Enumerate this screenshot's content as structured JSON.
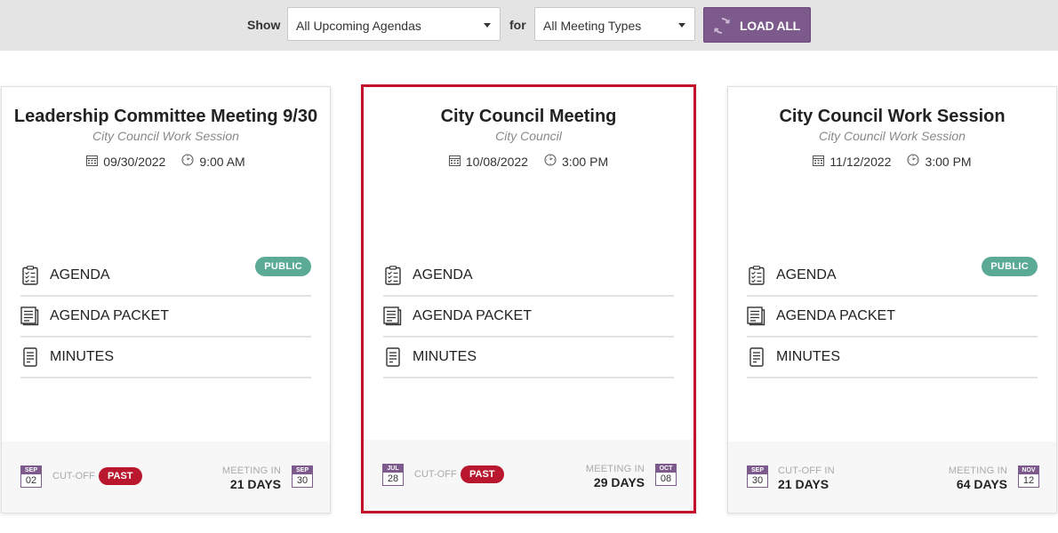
{
  "filters": {
    "show_label": "Show",
    "show_value": "All Upcoming Agendas",
    "for_label": "for",
    "for_value": "All Meeting Types",
    "load_all_label": "LOAD ALL"
  },
  "colors": {
    "accent": "#7d5a8c",
    "selected_border": "#c4102a",
    "public_badge": "#5aaa96",
    "past_badge": "#b8172e"
  },
  "cards": [
    {
      "title": "Leadership Committee Meeting 9/30",
      "subtitle": "City Council Work Session",
      "date": "09/30/2022",
      "time": "9:00 AM",
      "selected": false,
      "docs": [
        {
          "label": "AGENDA",
          "icon": "agenda-checklist-icon",
          "badge": "PUBLIC"
        },
        {
          "label": "AGENDA PACKET",
          "icon": "agenda-packet-icon"
        },
        {
          "label": "MINUTES",
          "icon": "minutes-icon"
        }
      ],
      "cutoff": {
        "month": "SEP",
        "day": "02",
        "label": "CUT-OFF",
        "status": "PAST"
      },
      "meeting": {
        "label": "MEETING IN",
        "days": "21 DAYS",
        "month": "SEP",
        "day": "30"
      }
    },
    {
      "title": "City Council Meeting",
      "subtitle": "City Council",
      "date": "10/08/2022",
      "time": "3:00 PM",
      "selected": true,
      "docs": [
        {
          "label": "AGENDA",
          "icon": "agenda-checklist-icon"
        },
        {
          "label": "AGENDA PACKET",
          "icon": "agenda-packet-icon"
        },
        {
          "label": "MINUTES",
          "icon": "minutes-icon"
        }
      ],
      "cutoff": {
        "month": "JUL",
        "day": "28",
        "label": "CUT-OFF",
        "status": "PAST"
      },
      "meeting": {
        "label": "MEETING IN",
        "days": "29 DAYS",
        "month": "OCT",
        "day": "08"
      }
    },
    {
      "title": "City Council Work Session",
      "subtitle": "City Council Work Session",
      "date": "11/12/2022",
      "time": "3:00 PM",
      "selected": false,
      "docs": [
        {
          "label": "AGENDA",
          "icon": "agenda-checklist-icon",
          "badge": "PUBLIC"
        },
        {
          "label": "AGENDA PACKET",
          "icon": "agenda-packet-icon"
        },
        {
          "label": "MINUTES",
          "icon": "minutes-icon"
        }
      ],
      "cutoff": {
        "month": "SEP",
        "day": "30",
        "label": "CUT-OFF IN",
        "days": "21 DAYS"
      },
      "meeting": {
        "label": "MEETING IN",
        "days": "64 DAYS",
        "month": "NOV",
        "day": "12"
      }
    }
  ]
}
